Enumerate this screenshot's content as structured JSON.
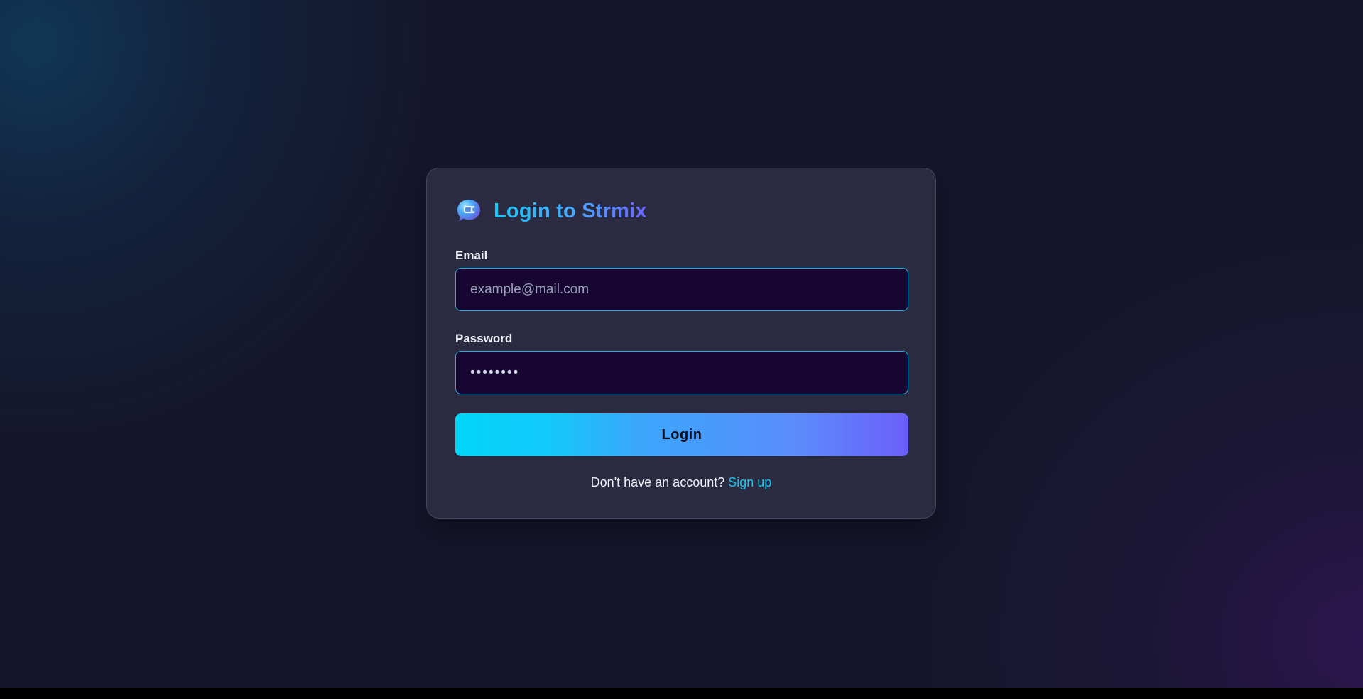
{
  "login": {
    "title": "Login to Strmix",
    "logo_icon": "chat-bubble-logo-icon",
    "email_label": "Email",
    "email_placeholder": "example@mail.com",
    "password_label": "Password",
    "password_value": "••••••••",
    "login_button": "Login",
    "signup_prompt": "Don't have an account?",
    "signup_link": "Sign up"
  },
  "colors": {
    "accent_cyan": "#14c8f4",
    "accent_purple": "#6b5ffb",
    "card_bg": "#2a2b41",
    "input_bg": "#170632",
    "page_bg": "#15162c"
  }
}
